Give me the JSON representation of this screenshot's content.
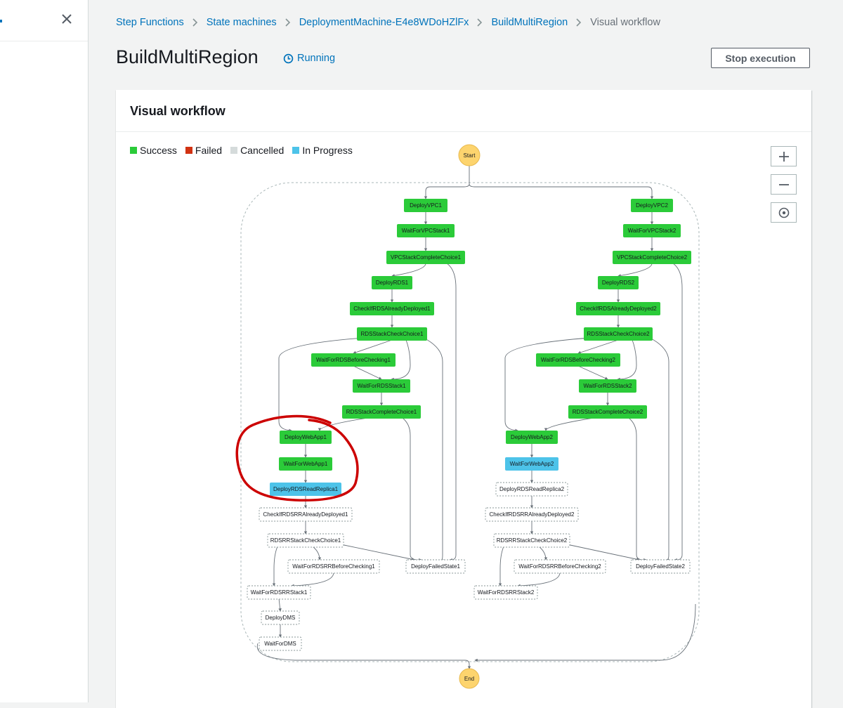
{
  "breadcrumb": {
    "items": [
      "Step Functions",
      "State machines",
      "DeploymentMachine-E4e8WDoHZlFx",
      "BuildMultiRegion"
    ],
    "current": "Visual workflow"
  },
  "page": {
    "title": "BuildMultiRegion",
    "status": "Running"
  },
  "actions": {
    "stop_label": "Stop execution"
  },
  "panel": {
    "title": "Visual workflow"
  },
  "legend": [
    {
      "label": "Success",
      "color": "#2bcb39"
    },
    {
      "label": "Failed",
      "color": "#d13212"
    },
    {
      "label": "Cancelled",
      "color": "#d5dbdb"
    },
    {
      "label": "In Progress",
      "color": "#4dc3e9"
    }
  ],
  "zoom": {
    "in_icon": "plus-icon",
    "out_icon": "minus-icon",
    "center_icon": "target-icon"
  },
  "colors": {
    "success": "#2bcb39",
    "in_progress": "#4dc3e9",
    "not_started": "#ffffff",
    "terminal": "#fdd46e",
    "annotation": "#cc0000",
    "link": "#0073bb"
  },
  "workflow": {
    "start_label": "Start",
    "end_label": "End",
    "states": [
      {
        "id": "DeployVPC1",
        "status": "success"
      },
      {
        "id": "WaitForVPCStack1",
        "status": "success"
      },
      {
        "id": "VPCStackCompleteChoice1",
        "status": "success"
      },
      {
        "id": "DeployRDS1",
        "status": "success"
      },
      {
        "id": "CheckIfRDSAlreadyDeployed1",
        "status": "success"
      },
      {
        "id": "RDSStackCheckChoice1",
        "status": "success"
      },
      {
        "id": "WaitForRDSBeforeChecking1",
        "status": "success"
      },
      {
        "id": "WaitForRDSStack1",
        "status": "success"
      },
      {
        "id": "RDSStackCompleteChoice1",
        "status": "success"
      },
      {
        "id": "DeployWebApp1",
        "status": "success"
      },
      {
        "id": "WaitForWebApp1",
        "status": "success"
      },
      {
        "id": "DeployRDSReadReplica1",
        "status": "in_progress"
      },
      {
        "id": "CheckIfRDSRRAlreadyDeployed1",
        "status": "not_started"
      },
      {
        "id": "RDSRRStackCheckChoice1",
        "status": "not_started"
      },
      {
        "id": "WaitForRDSRRBeforeChecking1",
        "status": "not_started"
      },
      {
        "id": "DeployFailedState1",
        "status": "not_started"
      },
      {
        "id": "WaitForRDSRRStack1",
        "status": "not_started"
      },
      {
        "id": "DeployDMS",
        "status": "not_started"
      },
      {
        "id": "WaitForDMS",
        "status": "not_started"
      },
      {
        "id": "DeployVPC2",
        "status": "success"
      },
      {
        "id": "WaitForVPCStack2",
        "status": "success"
      },
      {
        "id": "VPCStackCompleteChoice2",
        "status": "success"
      },
      {
        "id": "DeployRDS2",
        "status": "success"
      },
      {
        "id": "CheckIfRDSAlreadyDeployed2",
        "status": "success"
      },
      {
        "id": "RDSStackCheckChoice2",
        "status": "success"
      },
      {
        "id": "WaitForRDSBeforeChecking2",
        "status": "success"
      },
      {
        "id": "WaitForRDSStack2",
        "status": "success"
      },
      {
        "id": "RDSStackCompleteChoice2",
        "status": "success"
      },
      {
        "id": "DeployWebApp2",
        "status": "success"
      },
      {
        "id": "WaitForWebApp2",
        "status": "in_progress"
      },
      {
        "id": "DeployRDSReadReplica2",
        "status": "not_started"
      },
      {
        "id": "CheckIfRDSRRAlreadyDeployed2",
        "status": "not_started"
      },
      {
        "id": "RDSRRStackCheckChoice2",
        "status": "not_started"
      },
      {
        "id": "WaitForRDSRRBeforeChecking2",
        "status": "not_started"
      },
      {
        "id": "DeployFailedState2",
        "status": "not_started"
      },
      {
        "id": "WaitForRDSRRStack2",
        "status": "not_started"
      }
    ]
  }
}
